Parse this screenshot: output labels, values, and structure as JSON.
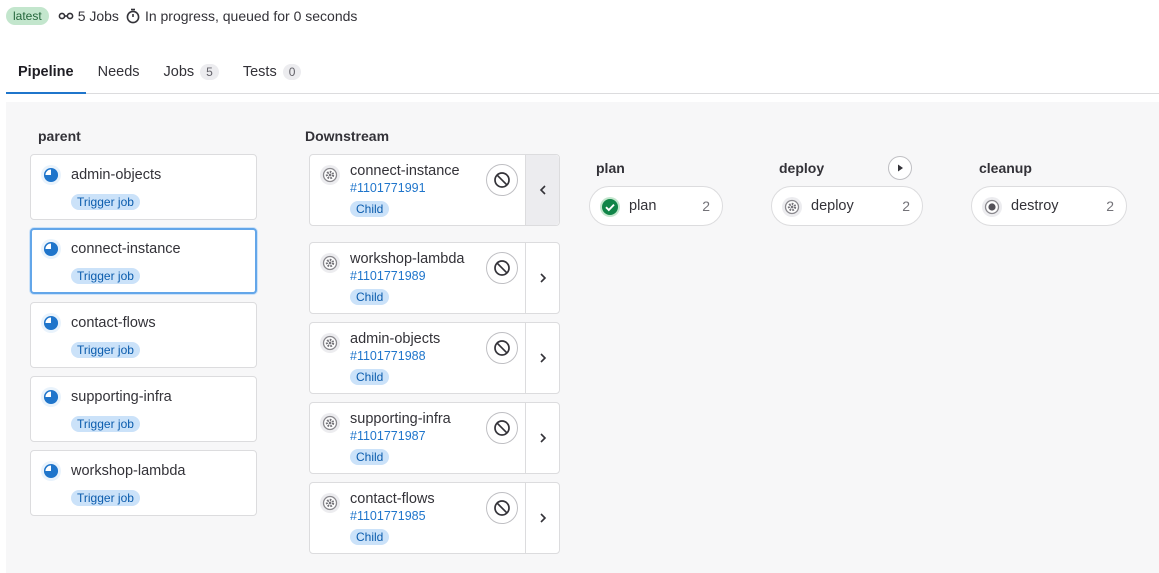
{
  "header": {
    "badge": "latest",
    "jobs_text": "5 Jobs",
    "status_text": "In progress, queued for 0 seconds"
  },
  "tabs": [
    {
      "label": "Pipeline",
      "count": null,
      "active": true
    },
    {
      "label": "Needs",
      "count": null,
      "active": false
    },
    {
      "label": "Jobs",
      "count": "5",
      "active": false
    },
    {
      "label": "Tests",
      "count": "0",
      "active": false
    }
  ],
  "parent": {
    "title": "parent",
    "jobs": [
      {
        "name": "admin-objects",
        "tag": "Trigger job"
      },
      {
        "name": "connect-instance",
        "tag": "Trigger job"
      },
      {
        "name": "contact-flows",
        "tag": "Trigger job"
      },
      {
        "name": "supporting-infra",
        "tag": "Trigger job"
      },
      {
        "name": "workshop-lambda",
        "tag": "Trigger job"
      }
    ]
  },
  "downstream": {
    "title": "Downstream",
    "pipelines": [
      {
        "name": "connect-instance",
        "id": "#1101771991",
        "tag": "Child"
      },
      {
        "name": "workshop-lambda",
        "id": "#1101771989",
        "tag": "Child"
      },
      {
        "name": "admin-objects",
        "id": "#1101771988",
        "tag": "Child"
      },
      {
        "name": "supporting-infra",
        "id": "#1101771987",
        "tag": "Child"
      },
      {
        "name": "contact-flows",
        "id": "#1101771985",
        "tag": "Child"
      }
    ]
  },
  "stages": [
    {
      "title": "plan",
      "job": "plan",
      "count": "2",
      "status": "success"
    },
    {
      "title": "deploy",
      "job": "deploy",
      "count": "2",
      "status": "created"
    },
    {
      "title": "cleanup",
      "job": "destroy",
      "count": "2",
      "status": "manual"
    }
  ],
  "colors": {
    "accent": "#1f75cb",
    "success": "#108548",
    "running": "#1f75cb",
    "badge_bg": "#cbe2f9"
  },
  "icons": {
    "running": "running-status-icon",
    "created": "gear-status-icon",
    "cancel": "cancel-icon",
    "play": "play-icon"
  }
}
